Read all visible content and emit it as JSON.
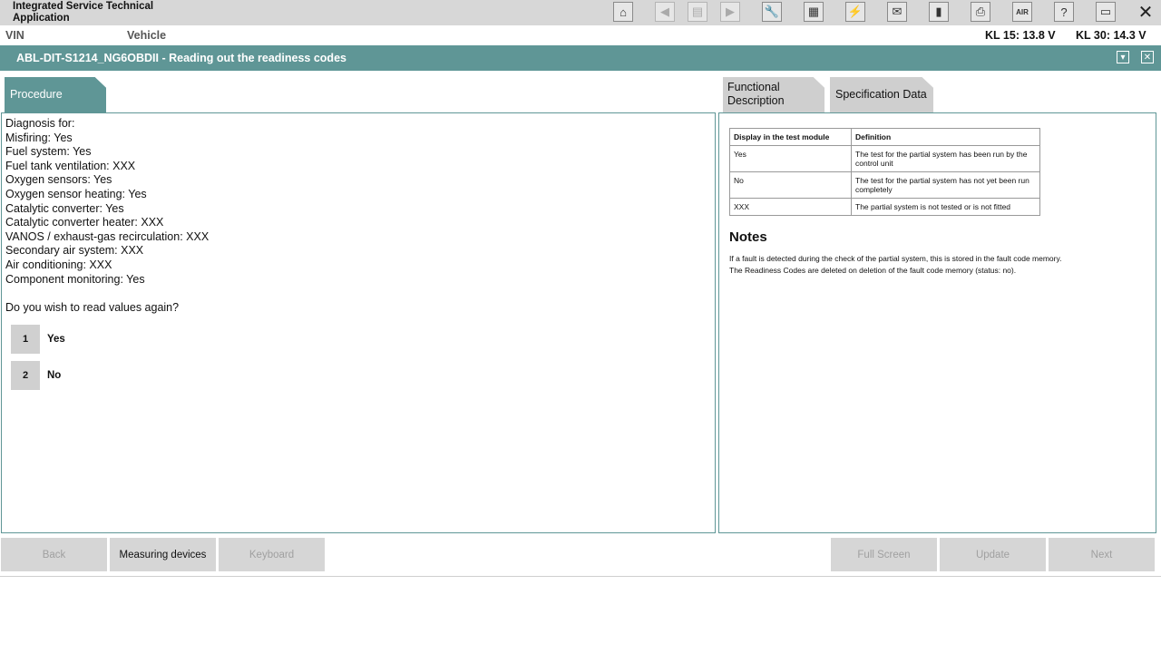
{
  "app": {
    "title": "Integrated Service Technical Application"
  },
  "toolbar": {
    "icons": [
      {
        "name": "home-icon",
        "glyph": "⌂",
        "enabled": true
      },
      {
        "name": "back-icon",
        "glyph": "◀",
        "enabled": false
      },
      {
        "name": "copy-pages-icon",
        "glyph": "▤",
        "enabled": false
      },
      {
        "name": "forward-icon",
        "glyph": "▶",
        "enabled": false
      },
      {
        "name": "wrench-icon",
        "glyph": "🔧",
        "enabled": true
      },
      {
        "name": "document-scan-icon",
        "glyph": "▦",
        "enabled": true
      },
      {
        "name": "connection-icon",
        "glyph": "⚡",
        "enabled": true
      },
      {
        "name": "mail-icon",
        "glyph": "✉",
        "enabled": true
      },
      {
        "name": "battery-icon",
        "glyph": "▮",
        "enabled": true
      },
      {
        "name": "printer-icon",
        "glyph": "⎙",
        "enabled": true
      },
      {
        "name": "air-icon",
        "glyph": "AIR",
        "enabled": true
      },
      {
        "name": "help-icon",
        "glyph": "?",
        "enabled": true
      },
      {
        "name": "minimize-window-icon",
        "glyph": "▭",
        "enabled": true
      }
    ],
    "close_glyph": "✕"
  },
  "info": {
    "vin_label": "VIN",
    "vehicle_label": "Vehicle",
    "kl15": "KL 15:  13.8 V",
    "kl30": "KL 30:  14.3 V"
  },
  "header": {
    "title": "ABL-DIT-S1214_NG6OBDII  -  Reading out the readiness codes",
    "minimize_glyph": "▾",
    "close_glyph": "✕"
  },
  "tabs": {
    "procedure": "Procedure",
    "functional_line1": "Functional",
    "functional_line2": "Description",
    "specification": "Specification Data"
  },
  "procedure": {
    "lines": [
      "Diagnosis for:",
      "Misfiring: Yes",
      "Fuel system: Yes",
      "Fuel tank ventilation: XXX",
      "Oxygen sensors: Yes",
      "Oxygen sensor heating: Yes",
      "Catalytic converter: Yes",
      "Catalytic converter heater: XXX",
      "VANOS / exhaust-gas recirculation: XXX",
      "Secondary air system: XXX",
      "Air conditioning: XXX",
      "Component monitoring: Yes"
    ],
    "question": "Do you wish to read values again?",
    "choices": [
      {
        "number": "1",
        "label": "Yes"
      },
      {
        "number": "2",
        "label": "No"
      }
    ]
  },
  "spec": {
    "headers": [
      "Display in the test module",
      "Definition"
    ],
    "rows": [
      [
        "Yes",
        "The test for the partial system has been run by the control unit"
      ],
      [
        "No",
        "The test for the partial system has not yet been run completely"
      ],
      [
        "XXX",
        "The partial system is not tested or is not fitted"
      ]
    ],
    "notes_title": "Notes",
    "notes": [
      "If a fault is detected during the check of the partial system, this is stored in the fault code memory.",
      "The Readiness Codes are deleted on deletion of the fault code memory (status: no)."
    ]
  },
  "bottom": {
    "back": "Back",
    "measuring": "Measuring devices",
    "keyboard": "Keyboard",
    "fullscreen": "Full Screen",
    "update": "Update",
    "next": "Next"
  }
}
